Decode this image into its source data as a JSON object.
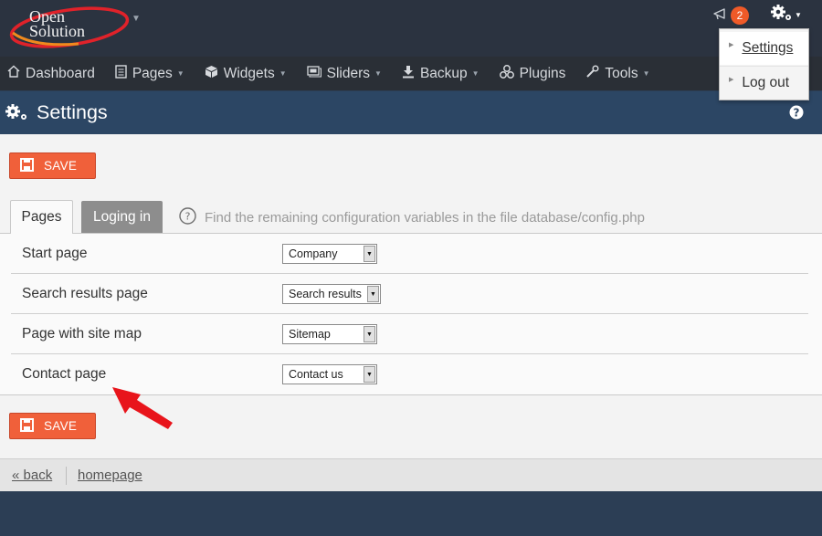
{
  "app": {
    "logo_line1": "Open",
    "logo_line2": "Solution",
    "notification_count": "2"
  },
  "nav": {
    "items": [
      {
        "label": "Dashboard",
        "icon": "home-icon",
        "has_caret": false
      },
      {
        "label": "Pages",
        "icon": "document-icon",
        "has_caret": true
      },
      {
        "label": "Widgets",
        "icon": "cube-icon",
        "has_caret": true
      },
      {
        "label": "Sliders",
        "icon": "slides-icon",
        "has_caret": true
      },
      {
        "label": "Backup",
        "icon": "download-icon",
        "has_caret": true
      },
      {
        "label": "Plugins",
        "icon": "puzzle-icon",
        "has_caret": false
      },
      {
        "label": "Tools",
        "icon": "wrench-icon",
        "has_caret": true
      }
    ]
  },
  "user_menu": {
    "settings_label": "Settings",
    "logout_label": "Log out"
  },
  "page": {
    "title": "Settings",
    "save_label": "SAVE"
  },
  "tabs": {
    "active": "Pages",
    "inactive": "Loging in",
    "hint": "Find the remaining configuration variables in the file database/config.php"
  },
  "settings_rows": [
    {
      "label": "Start page",
      "value": "Company"
    },
    {
      "label": "Search results page",
      "value": "Search results"
    },
    {
      "label": "Page with site map",
      "value": "Sitemap"
    },
    {
      "label": "Contact page",
      "value": "Contact us"
    }
  ],
  "footer": {
    "back_label": "« back",
    "homepage_label": "homepage"
  },
  "colors": {
    "accent": "#f0603a",
    "topbar": "#2b3340",
    "navbar": "#2a2f36",
    "titlebar": "#2c4664",
    "annotation_arrow": "#e8141b"
  }
}
